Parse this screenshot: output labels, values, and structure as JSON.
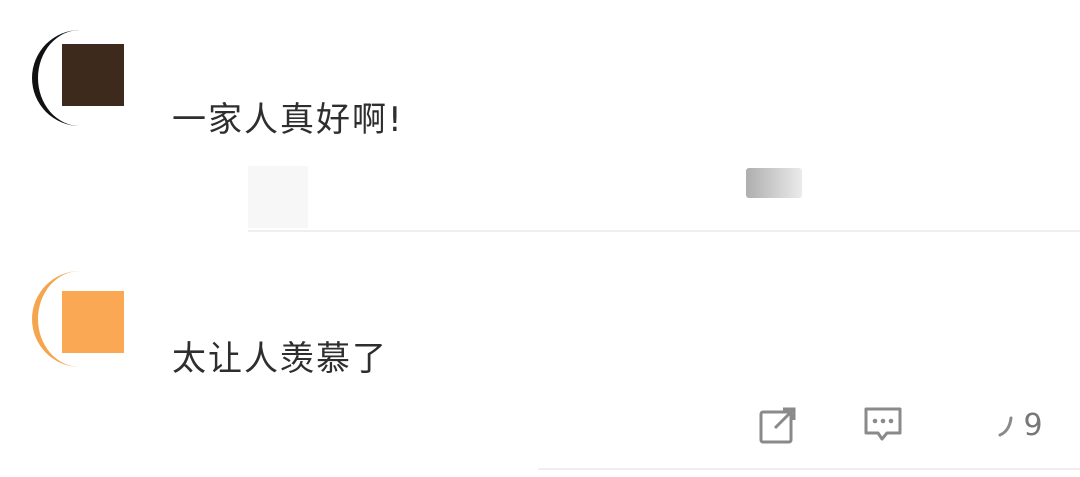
{
  "comments": [
    {
      "text": "一家人真好啊!"
    },
    {
      "text": "太让人羡慕了",
      "actions": {
        "share_icon": "share-icon",
        "reply_icon": "comment-icon",
        "like_icon": "thumbs-up-icon",
        "like_count": "9"
      }
    }
  ],
  "colors": {
    "avatar_1": "#3e2a1c",
    "avatar_2": "#fba854",
    "text": "#2e2e2e",
    "icon": "#8a8a8a",
    "divider": "#efefef"
  }
}
